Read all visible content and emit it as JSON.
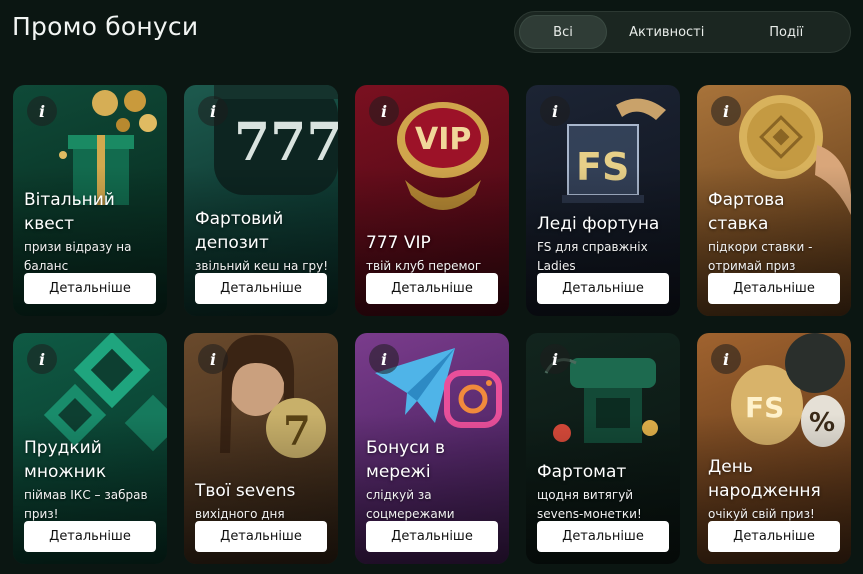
{
  "page_title": "Промо бонуси",
  "tabs": [
    {
      "label": "Всі",
      "active": true
    },
    {
      "label": "Активності",
      "active": false
    },
    {
      "label": "Події",
      "active": false
    }
  ],
  "cards": [
    {
      "title": "Вітальний квест",
      "subtitle": "призи відразу на баланс",
      "button": "Детальніше",
      "icon": "info-icon"
    },
    {
      "title": "Фартовий депозит",
      "subtitle": "звільний кеш на гру!",
      "button": "Детальніше",
      "icon": "info-icon"
    },
    {
      "title": "777 VIP",
      "subtitle": "твій клуб перемог",
      "button": "Детальніше",
      "icon": "info-icon"
    },
    {
      "title": "Леді фортуна",
      "subtitle": "FS для справжніх Ladies",
      "button": "Детальніше",
      "icon": "info-icon"
    },
    {
      "title": "Фартова ставка",
      "subtitle": "підкори ставки - отримай приз",
      "button": "Детальніше",
      "icon": "info-icon"
    },
    {
      "title": "Прудкий множник",
      "subtitle": "піймав ІКС – забрав приз!",
      "button": "Детальніше",
      "icon": "info-icon"
    },
    {
      "title": "Твої sevens",
      "subtitle": "вихідного дня",
      "button": "Детальніше",
      "icon": "info-icon"
    },
    {
      "title": "Бонуси в мережі",
      "subtitle": "слідкуй за соцмережами",
      "button": "Детальніше",
      "icon": "info-icon"
    },
    {
      "title": "Фартомат",
      "subtitle": "щодня витягуй sevens-монетки!",
      "button": "Детальніше",
      "icon": "info-icon"
    },
    {
      "title": "День народження",
      "subtitle": "очікуй свій приз!",
      "button": "Детальніше",
      "icon": "info-icon"
    }
  ],
  "art_text": {
    "vip": "VIP",
    "fs": "FS",
    "seven": "7",
    "seven_row": "777",
    "fs_balloon": "FS",
    "percent": "%"
  },
  "colors": {
    "background": "#0b1612",
    "tab_active": "#2f3c36",
    "button_bg": "#ffffff",
    "accent_gold": "#c9a24a"
  }
}
